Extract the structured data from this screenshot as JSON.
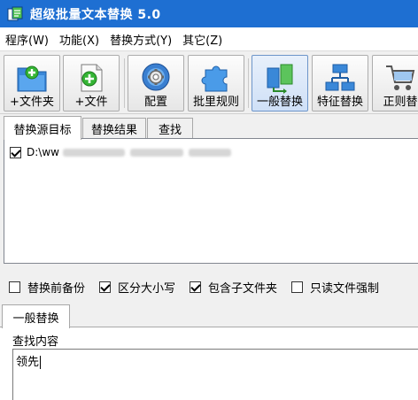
{
  "window": {
    "title": "超级批量文本替换 5.0"
  },
  "menu": [
    "程序(W)",
    "功能(X)",
    "替换方式(Y)",
    "其它(Z)"
  ],
  "toolbar": [
    {
      "label": "+文件夹",
      "icon": "folder-add-icon"
    },
    {
      "label": "+文件",
      "icon": "file-add-icon"
    },
    {
      "label": "配置",
      "icon": "gear-icon"
    },
    {
      "label": "批里规则",
      "icon": "puzzle-icon"
    },
    {
      "label": "一般替换",
      "icon": "general-replace-icon",
      "active": true
    },
    {
      "label": "特征替换",
      "icon": "feature-tree-icon"
    },
    {
      "label": "正则替",
      "icon": "cart-icon"
    }
  ],
  "source_tabs": [
    "替换源目标",
    "替换结果",
    "查找"
  ],
  "files": [
    {
      "path": "D:\\ww",
      "checked": true
    }
  ],
  "options": [
    {
      "label": "替换前备份",
      "checked": false
    },
    {
      "label": "区分大小写",
      "checked": true
    },
    {
      "label": "包含子文件夹",
      "checked": true
    },
    {
      "label": "只读文件强制",
      "checked": false
    }
  ],
  "mode_tab": "一般替换",
  "find": {
    "label": "查找内容",
    "value": "领先"
  },
  "colors": {
    "titlebar": "#1e6fd2",
    "active_tool": "#cfe0f7"
  }
}
